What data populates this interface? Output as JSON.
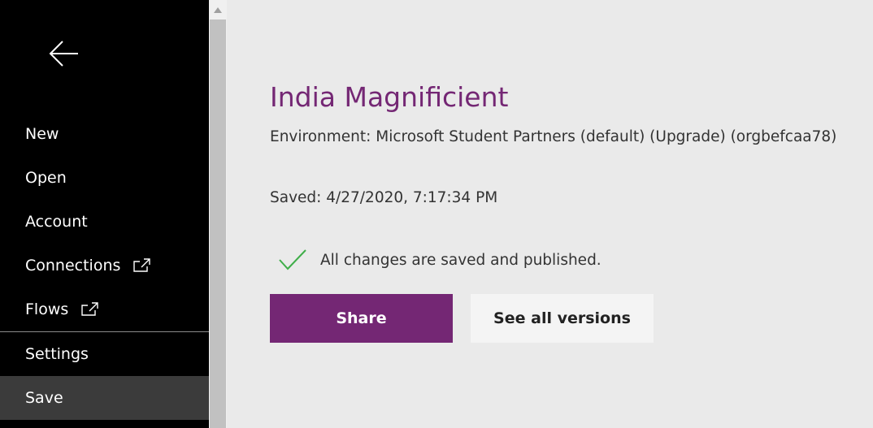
{
  "sidebar": {
    "back_icon": "arrow-left-icon",
    "items": [
      {
        "label": "New",
        "external": false
      },
      {
        "label": "Open",
        "external": false
      },
      {
        "label": "Account",
        "external": false
      },
      {
        "label": "Connections",
        "external": true
      },
      {
        "label": "Flows",
        "external": true
      },
      {
        "label": "Settings",
        "external": false
      },
      {
        "label": "Save",
        "external": false,
        "selected": true
      }
    ]
  },
  "main": {
    "app_title": "India Magnificient",
    "environment": "Environment: Microsoft Student Partners (default) (Upgrade) (orgbefcaa78)",
    "saved": "Saved: 4/27/2020, 7:17:34 PM",
    "status_message": "All changes are saved and published.",
    "share_label": "Share",
    "versions_label": "See all versions"
  },
  "colors": {
    "accent": "#742774",
    "check": "#3fae49",
    "sidebar_bg": "#000000",
    "selected_bg": "#3b3b3b",
    "content_bg": "#eaeaea"
  }
}
